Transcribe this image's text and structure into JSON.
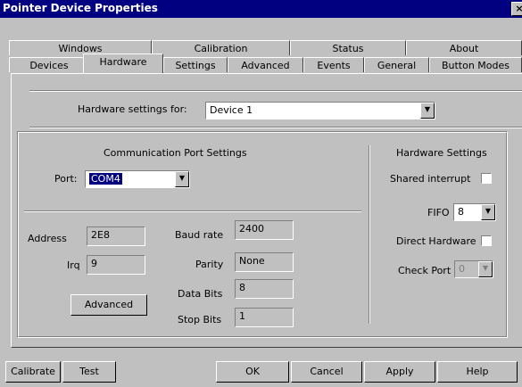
{
  "window": {
    "title": "Pointer Device Properties",
    "close_glyph": "×"
  },
  "tabs_row1": [
    "Windows",
    "Calibration",
    "Status",
    "About"
  ],
  "tabs_row2": [
    "Devices",
    "Hardware",
    "Settings",
    "Advanced",
    "Events",
    "General",
    "Button Modes"
  ],
  "active_tab": "Hardware",
  "hardware_for": {
    "label": "Hardware settings for:",
    "value": "Device 1"
  },
  "comm": {
    "title": "Communication Port Settings",
    "port_label": "Port:",
    "port_value": "COM4"
  },
  "fields": {
    "address_label": "Address",
    "address_value": "2E8",
    "irq_label": "Irq",
    "irq_value": "9",
    "baud_label": "Baud rate",
    "baud_value": "2400",
    "parity_label": "Parity",
    "parity_value": "None",
    "databits_label": "Data Bits",
    "databits_value": "8",
    "stopbits_label": "Stop Bits",
    "stopbits_value": "1",
    "advanced_button": "Advanced"
  },
  "hwsettings": {
    "title": "Hardware Settings",
    "shared_interrupt": "Shared interrupt",
    "shared_checked": false,
    "fifo_label": "FIFO",
    "fifo_value": "8",
    "direct_label": "Direct Hardware",
    "direct_checked": false,
    "checkport_label": "Check Port",
    "checkport_value": "0"
  },
  "bottom_buttons": {
    "calibrate": "Calibrate",
    "test": "Test",
    "ok": "OK",
    "cancel": "Cancel",
    "apply": "Apply",
    "help": "Help"
  }
}
